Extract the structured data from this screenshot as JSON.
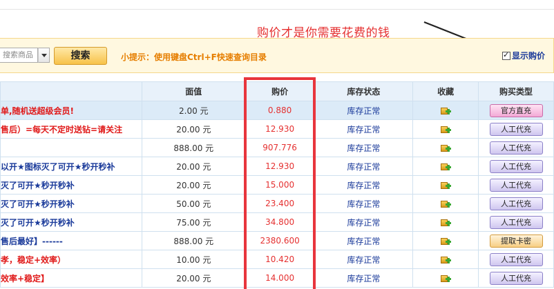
{
  "annotation": {
    "text": "购价才是你需要花费的钱"
  },
  "search": {
    "placeholder": "搜索商品",
    "button_label": "搜索",
    "tip": "小提示：使用键盘Ctrl+F快速查询目录",
    "show_price_label": "显示购价",
    "show_price_checked": true
  },
  "table": {
    "headers": [
      "",
      "面值",
      "购价",
      "库存状态",
      "收藏",
      "购买类型"
    ],
    "rows": [
      {
        "name": "单,随机送超级会员!",
        "name_style": "red",
        "face": "2.00 元",
        "price": "0.880",
        "stock": "库存正常",
        "buy": "官方直充",
        "buy_type": "official",
        "highlight": true
      },
      {
        "name": "售后）=每天不定时送钻=请关注",
        "name_style": "red",
        "face": "20.00 元",
        "price": "12.930",
        "stock": "库存正常",
        "buy": "人工代充",
        "buy_type": "manual"
      },
      {
        "name": "",
        "name_style": "blue",
        "face": "888.00 元",
        "price": "907.776",
        "stock": "库存正常",
        "buy": "人工代充",
        "buy_type": "manual"
      },
      {
        "name": "以开★图标灭了可开★秒开秒补",
        "name_style": "blue",
        "face": "20.00 元",
        "price": "12.930",
        "stock": "库存正常",
        "buy": "人工代充",
        "buy_type": "manual"
      },
      {
        "name": "灭了可开★秒开秒补",
        "name_style": "blue",
        "face": "20.00 元",
        "price": "15.000",
        "stock": "库存正常",
        "buy": "人工代充",
        "buy_type": "manual"
      },
      {
        "name": "灭了可开★秒开秒补",
        "name_style": "blue",
        "face": "50.00 元",
        "price": "23.400",
        "stock": "库存正常",
        "buy": "人工代充",
        "buy_type": "manual"
      },
      {
        "name": "灭了可开★秒开秒补",
        "name_style": "blue",
        "face": "75.00 元",
        "price": "34.800",
        "stock": "库存正常",
        "buy": "人工代充",
        "buy_type": "manual"
      },
      {
        "name": "售后最好】------",
        "name_style": "blue",
        "face": "888.00 元",
        "price": "2380.600",
        "stock": "库存正常",
        "buy": "提取卡密",
        "buy_type": "card"
      },
      {
        "name": "孝，稳定+效率）",
        "name_style": "red",
        "face": "10.00 元",
        "price": "10.420",
        "stock": "库存正常",
        "buy": "人工代充",
        "buy_type": "manual"
      },
      {
        "name": "效率+稳定】",
        "name_style": "red",
        "face": "20.00 元",
        "price": "14.000",
        "stock": "库存正常",
        "buy": "人工代充",
        "buy_type": "manual"
      }
    ]
  },
  "icons": {
    "favorite": "add-favorite-icon",
    "dropdown": "chevron-down-icon",
    "arrow": "annotation-arrow"
  }
}
